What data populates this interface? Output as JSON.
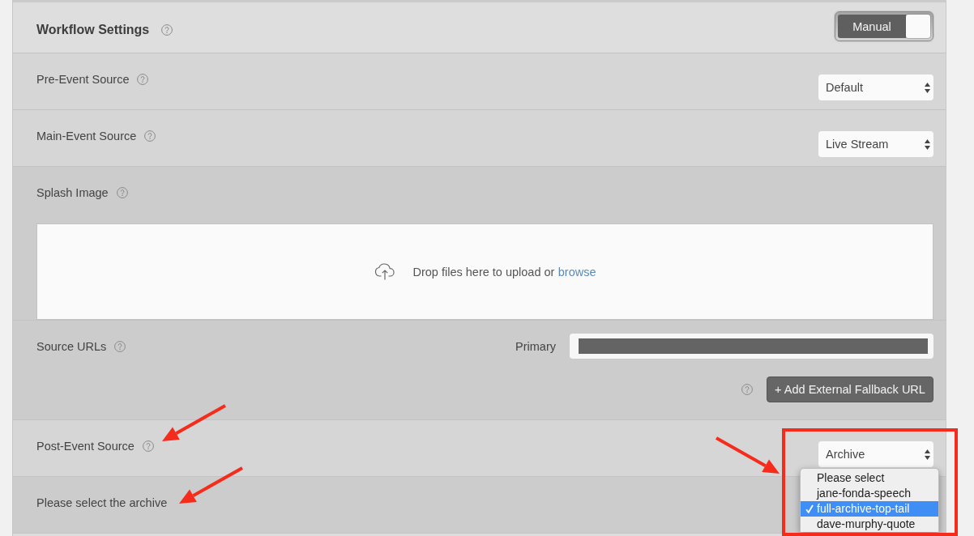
{
  "header": {
    "title": "Workflow Settings",
    "help": true,
    "toggle": {
      "label": "Manual",
      "on": true
    }
  },
  "rows": [
    {
      "kind": "select",
      "label": "Pre-Event Source",
      "help": true,
      "arrow": false,
      "select": {
        "value": "Default",
        "open": false,
        "callout": false
      }
    },
    {
      "kind": "select",
      "label": "Main-Event Source",
      "help": true,
      "arrow": false,
      "select": {
        "value": "Live Stream",
        "open": false,
        "callout": false
      }
    },
    {
      "kind": "upload",
      "label": "Splash Image",
      "help": true,
      "arrow": false,
      "dropzone": {
        "text": "Drop files here to upload or",
        "link": "browse"
      }
    },
    {
      "kind": "urls",
      "label": "Source URLs",
      "help": true,
      "arrow": false,
      "primary": {
        "label": "Primary",
        "redacted": true
      },
      "fallback": {
        "help": true,
        "button": "+ Add External Fallback URL"
      }
    },
    {
      "kind": "select",
      "label": "Post-Event Source",
      "help": true,
      "arrow": true,
      "select": {
        "value": "Archive",
        "open": true,
        "callout": true,
        "options": [
          {
            "label": "Please select",
            "selected": false
          },
          {
            "label": "jane-fonda-speech",
            "selected": false
          },
          {
            "label": "full-archive-top-tail",
            "selected": true
          },
          {
            "label": "dave-murphy-quote",
            "selected": false
          }
        ]
      }
    },
    {
      "kind": "text",
      "label": "Please select the archive",
      "help": false,
      "arrow": true
    }
  ]
}
